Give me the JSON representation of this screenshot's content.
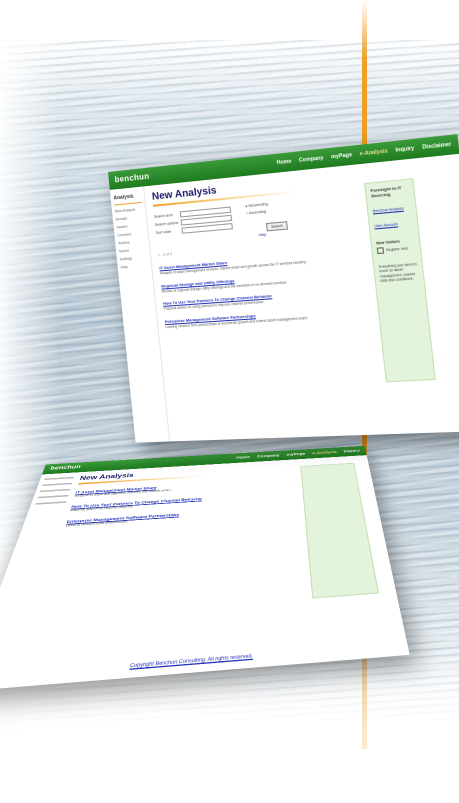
{
  "colors": {
    "brand_green": "#2a8a2a",
    "accent_orange": "#f0a028",
    "link_blue": "#2233bb",
    "panel_green": "#e4f4dc"
  },
  "front_screen": {
    "logo": "benchun",
    "nav": [
      "Home",
      "Company",
      "myPage",
      "e-Analysis",
      "Inquiry",
      "Disclaimer"
    ],
    "nav_selected_index": 3,
    "sidebar": {
      "title": "Analysis",
      "items": [
        "New Analysis",
        "Browse",
        "Search",
        "Compare",
        "Archive",
        "Saved",
        "Settings",
        "Help"
      ]
    },
    "page_title": "New Analysis",
    "form": {
      "labels": [
        "Search term",
        "Search options",
        "Sort order"
      ],
      "radio_options": [
        "Descending",
        "Ascending"
      ],
      "search_button": "Search",
      "help_link": "Help"
    },
    "results_count": "1 - 4 of 4",
    "results": [
      {
        "title": "IT Asset Management Market Share",
        "text": "Analysis of asset management vendors, market share and growth across the IT services industry."
      },
      {
        "title": "Regional Storage and Utility Offerings",
        "text": "Review of regional storage utility offerings and the evolution of on-demand services."
      },
      {
        "title": "How To Use Your Partners To Change Channel Behavior",
        "text": "Practical advice on using partners to improve channel performance."
      },
      {
        "title": "Enterprise Management Software Partnerships",
        "text": "Leading vendors form partnerships to accelerate growth and extend asset management reach."
      }
    ],
    "right_panel": {
      "title": "Foresight in IT Sourcing",
      "link_1": "Benchun Analysis",
      "link_2": "User Account",
      "subhead": "New Visitors",
      "check_label": "Register here",
      "text": "Everything you need to know on asset management, market data and conditions."
    }
  },
  "back_screen": {
    "logo": "benchun",
    "nav": [
      "Home",
      "Company",
      "myPage",
      "e-Analysis",
      "Inquiry"
    ],
    "nav_selected_index": 3,
    "page_title": "New Analysis",
    "results": [
      {
        "title": "IT Asset Management Market Share",
        "text": "Analysis of asset management vendors and market share."
      },
      {
        "title": "How To Use Your Partners To Change Channel Behavior",
        "text": "Practical advice on channel partners."
      },
      {
        "title": "Enterprise Management Software Partnerships",
        "text": "Leading vendors form partnerships."
      }
    ],
    "footer": "Copyright Benchun Consulting. All rights reserved.",
    "left_link": "Home   e-Analysis"
  }
}
